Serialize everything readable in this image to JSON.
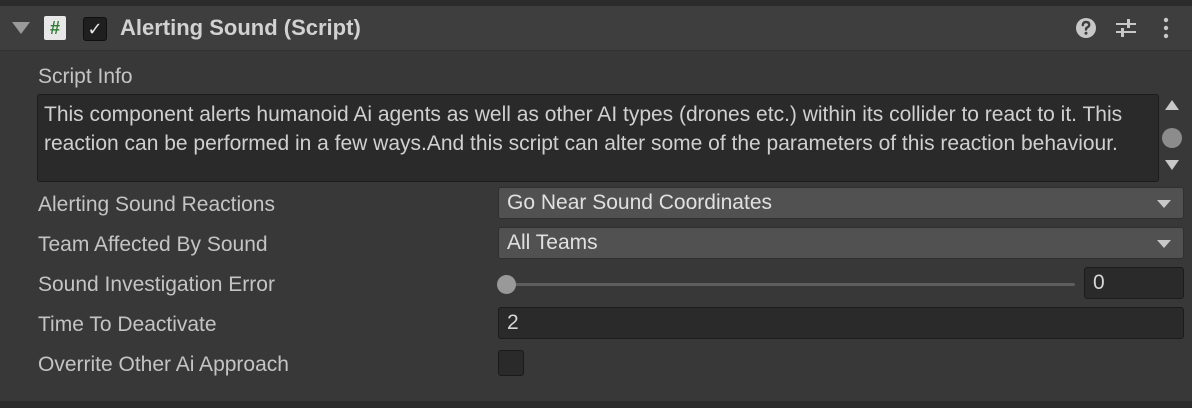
{
  "component": {
    "title": "Alerting Sound (Script)",
    "enabled": true,
    "icons": {
      "foldout": "foldout-triangle-icon",
      "script": "script-hash-icon",
      "help": "help-icon",
      "presets": "presets-icon",
      "menu": "kebab-menu-icon"
    },
    "script_icon_glyph": "#",
    "checkmark_glyph": "✓"
  },
  "script_info": {
    "label": "Script Info",
    "text": "This component alerts humanoid Ai agents as well as other AI types (drones etc.) within its collider to react to it. This reaction can be performed in a few ways.And this script can alter some of the parameters of this reaction behaviour."
  },
  "fields": {
    "alerting_sound_reactions": {
      "label": "Alerting Sound Reactions",
      "value": "Go Near Sound Coordinates"
    },
    "team_affected_by_sound": {
      "label": "Team Affected By Sound",
      "value": "All Teams"
    },
    "sound_investigation_error": {
      "label": "Sound Investigation Error",
      "value": "0",
      "slider_fraction": 0
    },
    "time_to_deactivate": {
      "label": "Time To Deactivate",
      "value": "2"
    },
    "overrite_other_ai_approach": {
      "label": "Overrite Other Ai Approach",
      "checked": false
    }
  },
  "colors": {
    "background": "#383838",
    "header": "#3e3e3e",
    "field_bg": "#2a2a2a",
    "dropdown_bg": "#515151",
    "text": "#c4c4c4",
    "script_icon_green": "#2f7a36"
  }
}
